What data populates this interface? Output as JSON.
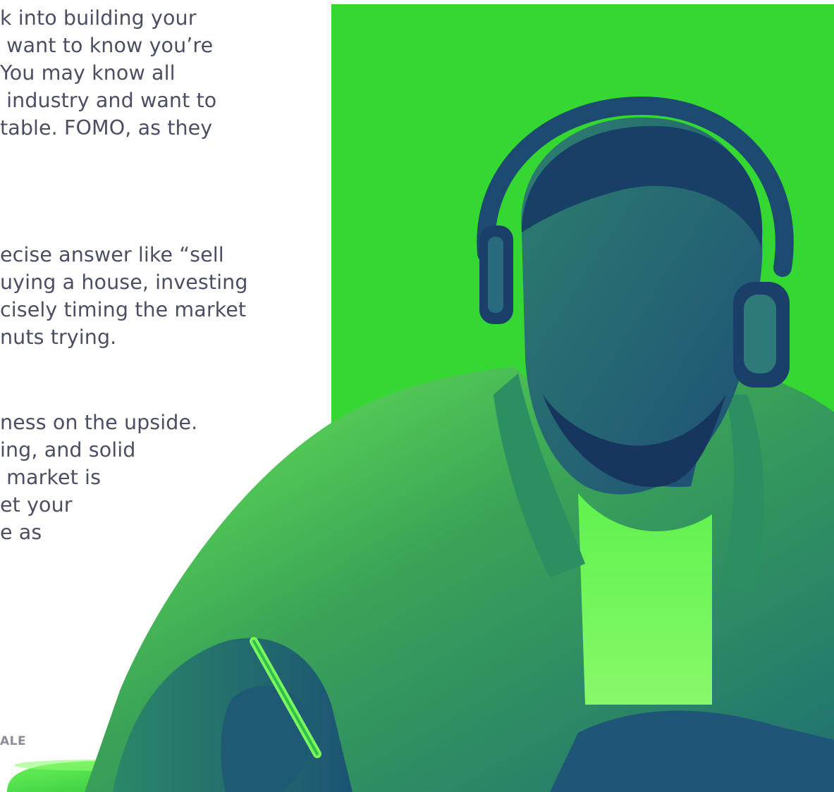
{
  "article": {
    "paragraphs": [
      {
        "lines": [
          "k into building your",
          " want to know you’re",
          "You may know all",
          " industry and want to",
          "table. FOMO, as they"
        ]
      },
      {
        "lines": [
          "ecise answer like “sell",
          "uying a house, investing",
          "cisely timing the market",
          "nuts trying."
        ]
      },
      {
        "lines": [
          "ness on the upside.",
          "ing, and solid",
          " market is",
          "et your",
          "e as"
        ]
      }
    ],
    "footer_label": "ALE"
  },
  "hero_image": {
    "alt_subject": "man-with-headphones-writing",
    "background_color": "#35d832",
    "duotone_dark": "#1f5a7a",
    "duotone_light": "#5cf04a"
  }
}
